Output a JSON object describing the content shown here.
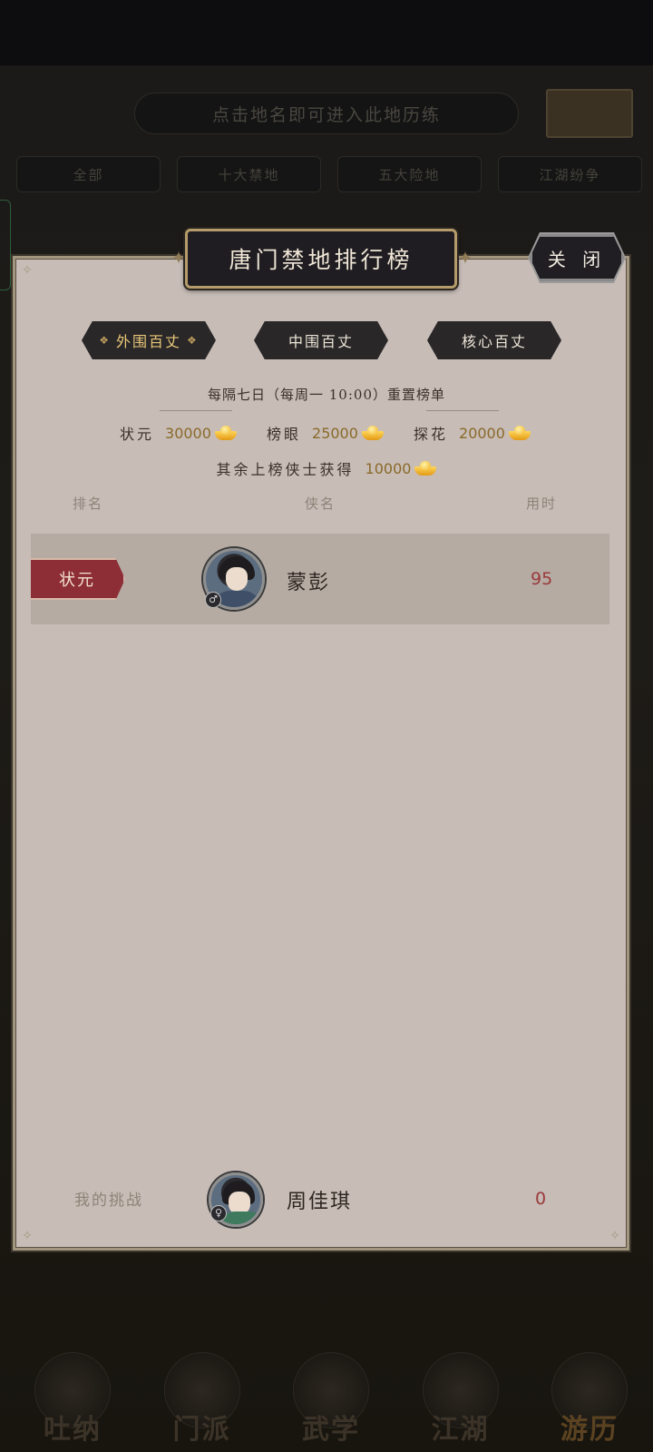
{
  "background": {
    "hint_text": "点击地名即可进入此地历练",
    "tabs": [
      "全部",
      "十大禁地",
      "五大险地",
      "江湖纷争"
    ],
    "nav": [
      {
        "label": "吐纳",
        "active": false
      },
      {
        "label": "门派",
        "active": false
      },
      {
        "label": "武学",
        "active": false
      },
      {
        "label": "江湖",
        "active": false
      },
      {
        "label": "游历",
        "active": true
      }
    ]
  },
  "modal": {
    "title": "唐门禁地排行榜",
    "close_label": "关 闭",
    "tabs": [
      {
        "label": "外围百丈",
        "active": true
      },
      {
        "label": "中围百丈",
        "active": false
      },
      {
        "label": "核心百丈",
        "active": false
      }
    ],
    "reset_text": "每隔七日（每周一 10:00）重置榜单",
    "rewards": [
      {
        "label": "状元",
        "amount": "30000",
        "icon": "gold-ingot-icon"
      },
      {
        "label": "榜眼",
        "amount": "25000",
        "icon": "gold-ingot-icon"
      },
      {
        "label": "探花",
        "amount": "20000",
        "icon": "gold-ingot-icon"
      }
    ],
    "others_reward": {
      "label": "其余上榜侠士获得",
      "amount": "10000",
      "icon": "gold-ingot-icon"
    },
    "columns": {
      "rank": "排名",
      "name": "侠名",
      "time": "用时"
    },
    "rows": [
      {
        "rank": "状元",
        "name": "蒙彭",
        "time": "95",
        "gender_icon": "male-icon"
      }
    ],
    "my_challenge": {
      "label": "我的挑战",
      "name": "周佳琪",
      "time": "0",
      "gender_icon": "female-icon"
    }
  },
  "colors": {
    "panel_bg": "#c7bcb6",
    "row_highlight": "#b5aba3",
    "rank_badge": "#8d2e36",
    "time_text": "#9a3a3a",
    "gold": "#e9c878"
  }
}
